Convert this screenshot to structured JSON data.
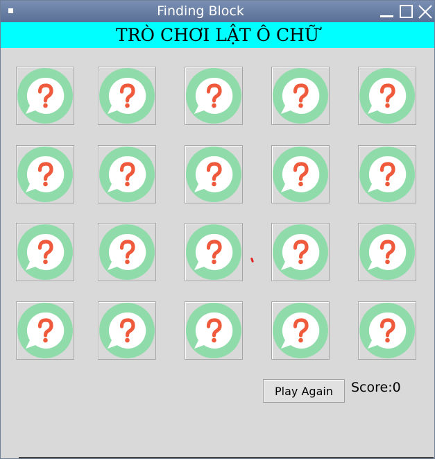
{
  "window": {
    "title": "Finding Block",
    "controls": [
      "minimize-icon",
      "maximize-icon",
      "close-icon"
    ]
  },
  "banner": {
    "text": "TRÒ CHƠI LẬT Ô CHỮ",
    "background": "#00ffff"
  },
  "grid": {
    "rows": 4,
    "columns": 5,
    "tile_icon": "question-bubble-icon",
    "colors": {
      "ring": "#8fdcaa",
      "bubble": "#ffffff",
      "mark": "#f05a3c"
    }
  },
  "controls": {
    "play_again_label": "Play Again"
  },
  "score": {
    "text": "Score:0"
  }
}
